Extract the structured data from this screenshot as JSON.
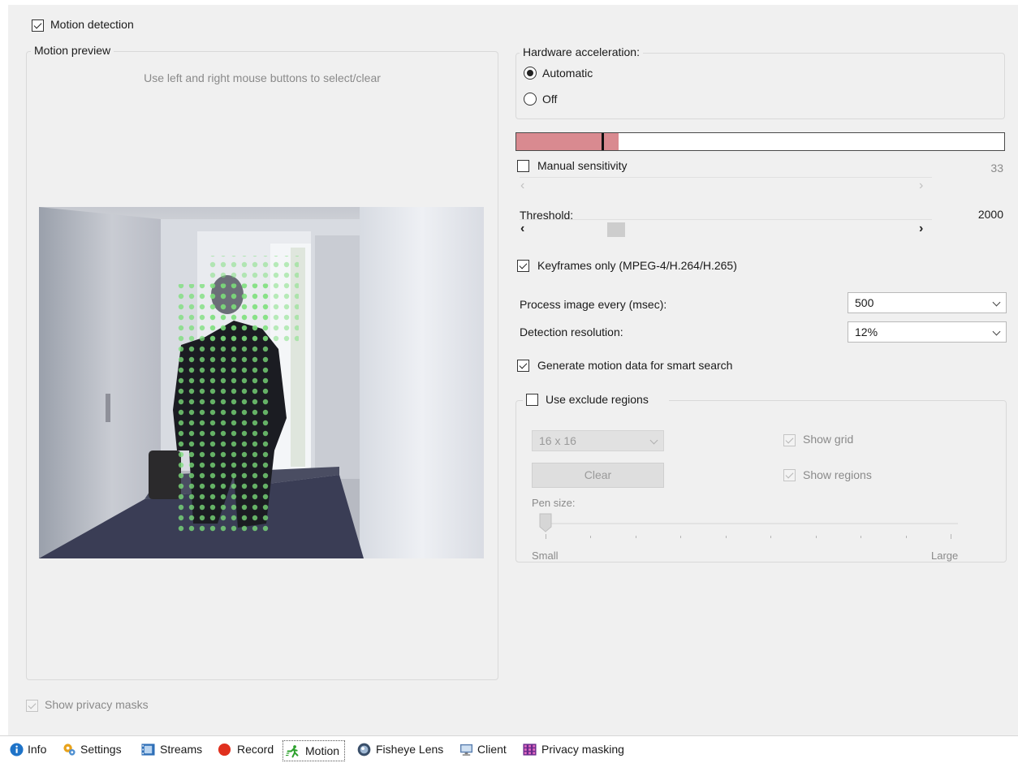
{
  "motion_detection": {
    "label": "Motion detection",
    "checked": true
  },
  "preview": {
    "title": "Motion preview",
    "hint": "Use left and right mouse buttons to select/clear"
  },
  "privacy": {
    "label": "Show privacy masks",
    "checked": true,
    "enabled": false
  },
  "hardware": {
    "title": "Hardware acceleration:",
    "options": [
      "Automatic",
      "Off"
    ],
    "selected": "Automatic"
  },
  "motion_level": {
    "fill_fraction": 0.21,
    "marker_fraction": 0.175,
    "fill_color": "#d98a90"
  },
  "sensitivity": {
    "label": "Manual sensitivity",
    "checked": false,
    "value": "33"
  },
  "threshold": {
    "label": "Threshold:",
    "value": "2000"
  },
  "keyframes": {
    "label": "Keyframes only (MPEG-4/H.264/H.265)",
    "checked": true
  },
  "process_image": {
    "label": "Process image every (msec):",
    "value": "500"
  },
  "detection_resolution": {
    "label": "Detection resolution:",
    "value": "12%"
  },
  "smart_search": {
    "label": "Generate motion data for smart search",
    "checked": true
  },
  "exclude": {
    "label": "Use exclude regions",
    "checked": false,
    "grid_size": "16 x 16",
    "clear_label": "Clear",
    "show_grid": "Show grid",
    "show_regions": "Show regions",
    "pen_size_label": "Pen size:",
    "small_label": "Small",
    "large_label": "Large"
  },
  "tabs": [
    {
      "label": "Info",
      "icon": "info-icon"
    },
    {
      "label": "Settings",
      "icon": "settings-icon"
    },
    {
      "label": "Streams",
      "icon": "streams-icon"
    },
    {
      "label": "Record",
      "icon": "record-icon"
    },
    {
      "label": "Motion",
      "icon": "motion-icon",
      "active": true
    },
    {
      "label": "Fisheye Lens",
      "icon": "fisheye-icon"
    },
    {
      "label": "Client",
      "icon": "client-icon"
    },
    {
      "label": "Privacy masking",
      "icon": "privacy-masking-icon"
    }
  ]
}
